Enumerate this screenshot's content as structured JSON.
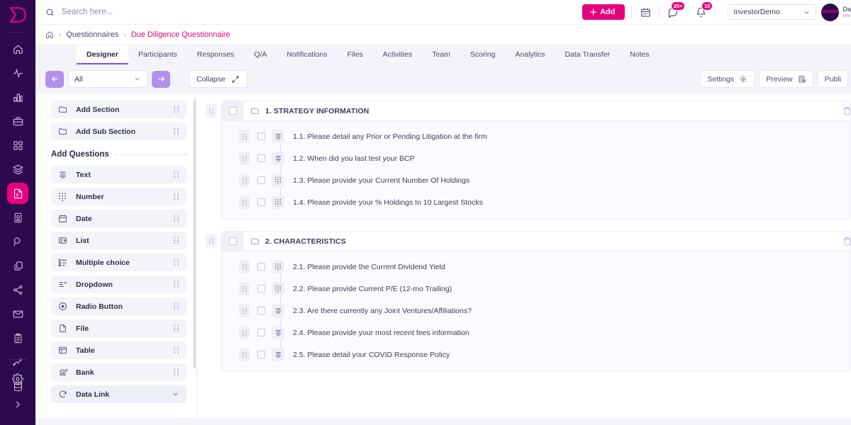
{
  "app": {
    "logo_icon": "logo-d-icon"
  },
  "sidebar": {
    "items": [
      {
        "icon": "home-icon",
        "name": "home",
        "active": false
      },
      {
        "icon": "activity-icon",
        "name": "activity",
        "active": false
      },
      {
        "icon": "bar-chart-icon",
        "name": "reports",
        "active": false
      },
      {
        "icon": "briefcase-icon",
        "name": "portfolio",
        "active": false
      },
      {
        "icon": "grid-icon",
        "name": "dashboard",
        "active": false
      },
      {
        "icon": "layers-icon",
        "name": "layers",
        "active": false
      },
      {
        "icon": "document-icon",
        "name": "questionnaires",
        "active": true
      },
      {
        "icon": "certificate-icon",
        "name": "certificates",
        "active": false
      },
      {
        "icon": "search-circle-icon",
        "name": "research",
        "active": false
      },
      {
        "icon": "copy-icon",
        "name": "documents",
        "active": false
      },
      {
        "icon": "share-nodes-icon",
        "name": "network",
        "active": false
      },
      {
        "icon": "envelope-icon",
        "name": "mail",
        "active": false
      },
      {
        "icon": "clipboard-icon",
        "name": "tasks",
        "active": false
      },
      {
        "icon": "line-chart-icon",
        "name": "analytics",
        "active": false
      },
      {
        "icon": "database-icon",
        "name": "data",
        "active": false
      }
    ],
    "bottom_items": [
      {
        "icon": "gear-icon",
        "name": "settings"
      },
      {
        "icon": "chevron-right-icon",
        "name": "expand-sidebar"
      }
    ]
  },
  "header": {
    "search_placeholder": "Search here...",
    "search_value": "",
    "search_icon": "search-icon",
    "add_label": "Add",
    "add_icon": "plus-icon",
    "calendar_icon": "calendar-icon",
    "chat_icon": "chat-icon",
    "chat_badge": "20+",
    "bell_icon": "bell-icon",
    "bell_badge": "10",
    "org_value": "InvestorDemo",
    "org_chevron": "chevron-down-icon",
    "avatar_name": "Da",
    "avatar_role": "Inv",
    "avatar_logo_text": "DILIGEND"
  },
  "breadcrumb": {
    "home_icon": "home-icon",
    "sep": "›",
    "parent": "Questionnaires",
    "current": "Due Diligence Questionnaire"
  },
  "tabs": [
    {
      "label": "Designer",
      "active": true
    },
    {
      "label": "Participants",
      "active": false
    },
    {
      "label": "Responses",
      "active": false
    },
    {
      "label": "Q/A",
      "active": false
    },
    {
      "label": "Notifications",
      "active": false
    },
    {
      "label": "Files",
      "active": false
    },
    {
      "label": "Activities",
      "active": false
    },
    {
      "label": "Team",
      "active": false
    },
    {
      "label": "Scoring",
      "active": false
    },
    {
      "label": "Analytics",
      "active": false
    },
    {
      "label": "Data Transfer",
      "active": false
    },
    {
      "label": "Notes",
      "active": false
    }
  ],
  "toolbar": {
    "back_icon": "arrow-left-icon",
    "forward_icon": "arrow-right-icon",
    "filter_value": "All",
    "filter_chevron": "chevron-down-icon",
    "collapse_label": "Collapse",
    "collapse_icon": "collapse-arrows-icon",
    "settings_label": "Settings",
    "settings_icon": "gear-icon",
    "preview_label": "Preview",
    "preview_icon": "preview-icon",
    "publish_label": "Publi"
  },
  "palette": {
    "structure_items": [
      {
        "label": "Add Section",
        "icon": "folder-icon"
      },
      {
        "label": "Add Sub Section",
        "icon": "folder-icon"
      }
    ],
    "questions_heading": "Add Questions",
    "question_items": [
      {
        "label": "Text",
        "icon": "text-icon"
      },
      {
        "label": "Number",
        "icon": "number-icon"
      },
      {
        "label": "Date",
        "icon": "calendar-icon"
      },
      {
        "label": "List",
        "icon": "list-icon"
      },
      {
        "label": "Multiple choice",
        "icon": "multiple-choice-icon"
      },
      {
        "label": "Dropdown",
        "icon": "dropdown-icon"
      },
      {
        "label": "Radio Button",
        "icon": "radio-icon"
      },
      {
        "label": "File",
        "icon": "file-icon"
      },
      {
        "label": "Table",
        "icon": "table-icon"
      },
      {
        "label": "Bank",
        "icon": "bank-icon"
      }
    ],
    "data_link": {
      "label": "Data Link",
      "icon": "data-link-icon",
      "chevron": "chevron-down-icon"
    },
    "grip_icon": "drag-handle-icon"
  },
  "canvas": {
    "sections": [
      {
        "title": "1. STRATEGY INFORMATION",
        "folder_icon": "folder-icon",
        "trash_icon": "trash-icon",
        "questions": [
          {
            "label": "1.1. Please detail any Prior or Pending Litigation at the firm",
            "type": "text-icon"
          },
          {
            "label": "1.2. When did you last test your BCP",
            "type": "text-icon"
          },
          {
            "label": "1.3. Please provide your Current Number Of Holdings",
            "type": "number-icon"
          },
          {
            "label": "1.4. Please provide your % Holdings In 10 Largest Stocks",
            "type": "number-icon"
          }
        ]
      },
      {
        "title": "2. CHARACTERISTICS",
        "folder_icon": "folder-icon",
        "trash_icon": "trash-icon",
        "questions": [
          {
            "label": "2.1. Please provide the Current Dividend Yield",
            "type": "number-icon"
          },
          {
            "label": "2.2. Please provide Current P/E (12-mo Trailing)",
            "type": "number-icon"
          },
          {
            "label": "2.3. Are there currently any Joint Ventures/Affiliations?",
            "type": "text-icon"
          },
          {
            "label": "2.4. Please provide your most recent fees information",
            "type": "text-icon"
          },
          {
            "label": "2.5. Please detail your COVID Response Policy",
            "type": "text-icon"
          }
        ]
      }
    ]
  },
  "colors": {
    "brand_pink": "#e6007e",
    "sidebar_purple": "#2d0a4e",
    "accent_violet": "#7c4dff",
    "button_violet": "#b191ec"
  }
}
